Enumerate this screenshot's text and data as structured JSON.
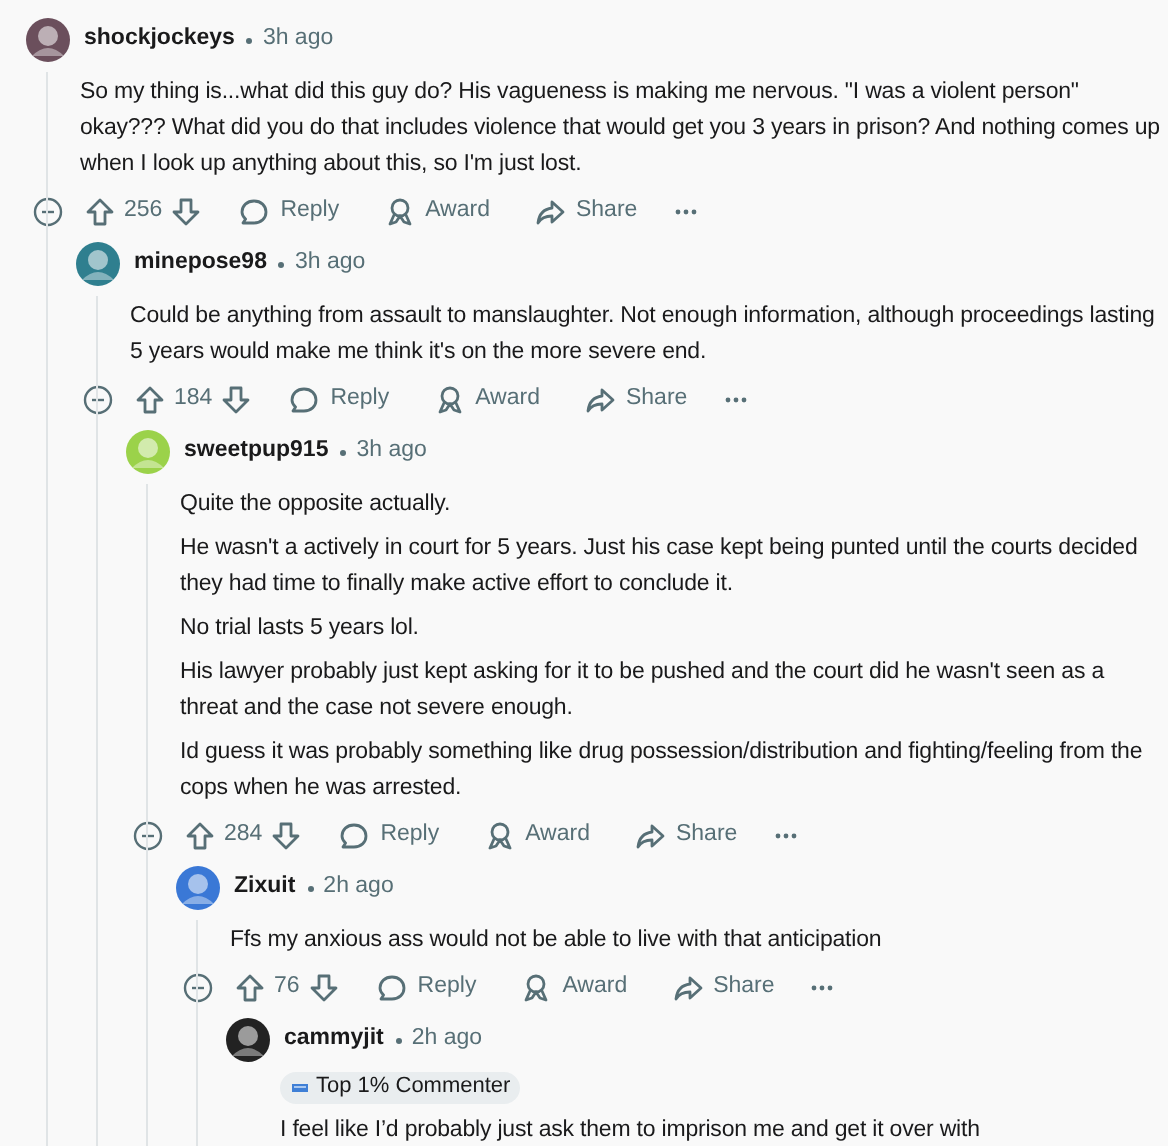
{
  "comments": [
    {
      "username": "shockjockeys",
      "time": "3h ago",
      "paragraphs": [
        "So my thing is...what did this guy do? His vagueness is making me nervous. \"I was a violent person\" okay??? What did you do that includes violence that would get you 3 years in prison? And nothing comes up when I look up anything about this, so I'm just lost."
      ],
      "score": "256",
      "actions": [
        "Reply",
        "Award",
        "Share"
      ],
      "children": [
        {
          "username": "minepose98",
          "time": "3h ago",
          "paragraphs": [
            "Could be anything from assault to manslaughter. Not enough information, although proceedings lasting 5 years would make me think it's on the more severe end."
          ],
          "score": "184",
          "actions": [
            "Reply",
            "Award",
            "Share"
          ],
          "children": [
            {
              "username": "sweetpup915",
              "time": "3h ago",
              "paragraphs": [
                "Quite the opposite actually.",
                "He wasn't a actively in court for 5 years. Just his case kept being punted until the courts decided they had time to finally make active effort to conclude it.",
                "No trial lasts 5 years lol.",
                "His lawyer probably just kept asking for it to be pushed and the court did he wasn't seen as a threat and the case not severe enough.",
                "Id guess it was probably something like drug possession/distribution and fighting/feeling from the cops when he was arrested."
              ],
              "score": "284",
              "actions": [
                "Reply",
                "Award",
                "Share"
              ],
              "children": [
                {
                  "username": "Zixuit",
                  "time": "2h ago",
                  "paragraphs": [
                    "Ffs my anxious ass would not be able to live with that anticipation"
                  ],
                  "score": "76",
                  "actions": [
                    "Reply",
                    "Award",
                    "Share"
                  ],
                  "children": [
                    {
                      "username": "cammyjit",
                      "time": "2h ago",
                      "badge": "Top 1% Commenter",
                      "paragraphs": [
                        "I feel like I’d probably just ask them to imprison me and get it over with"
                      ]
                    }
                  ]
                }
              ]
            }
          ]
        }
      ]
    }
  ]
}
